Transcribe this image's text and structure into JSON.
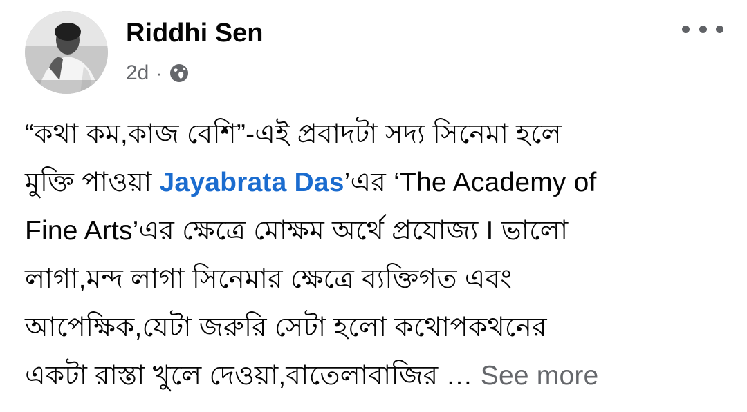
{
  "post": {
    "author": "Riddhi Sen",
    "timestamp": "2d",
    "separator": "·",
    "privacy_icon": "globe-icon",
    "lines": [
      "“কথা কম,কাজ বেশি”-এই প্রবাদটা সদ্য সিনেমা হলে",
      "",
      "Fine Arts’এর ক্ষেত্রে মোক্ষম অর্থে প্রযোজ্য I ভালো",
      "লাগা,মন্দ লাগা সিনেমার ক্ষেত্রে ব্যক্তিগত এবং",
      "আপেক্ষিক,যেটা জরুরি সেটা হলো কথোপকথনের",
      ""
    ],
    "line2_prefix": "মুক্তি পাওয়া ",
    "mention": "Jayabrata Das",
    "line2_suffix": "’এর ‘The Academy of",
    "last_line": "একটা রাস্তা খুলে দেওয়া,বাতেলাবাজির … ",
    "see_more": "See more"
  },
  "colors": {
    "mention": "#1b6ccf",
    "meta": "#65676b",
    "text": "#050505"
  }
}
